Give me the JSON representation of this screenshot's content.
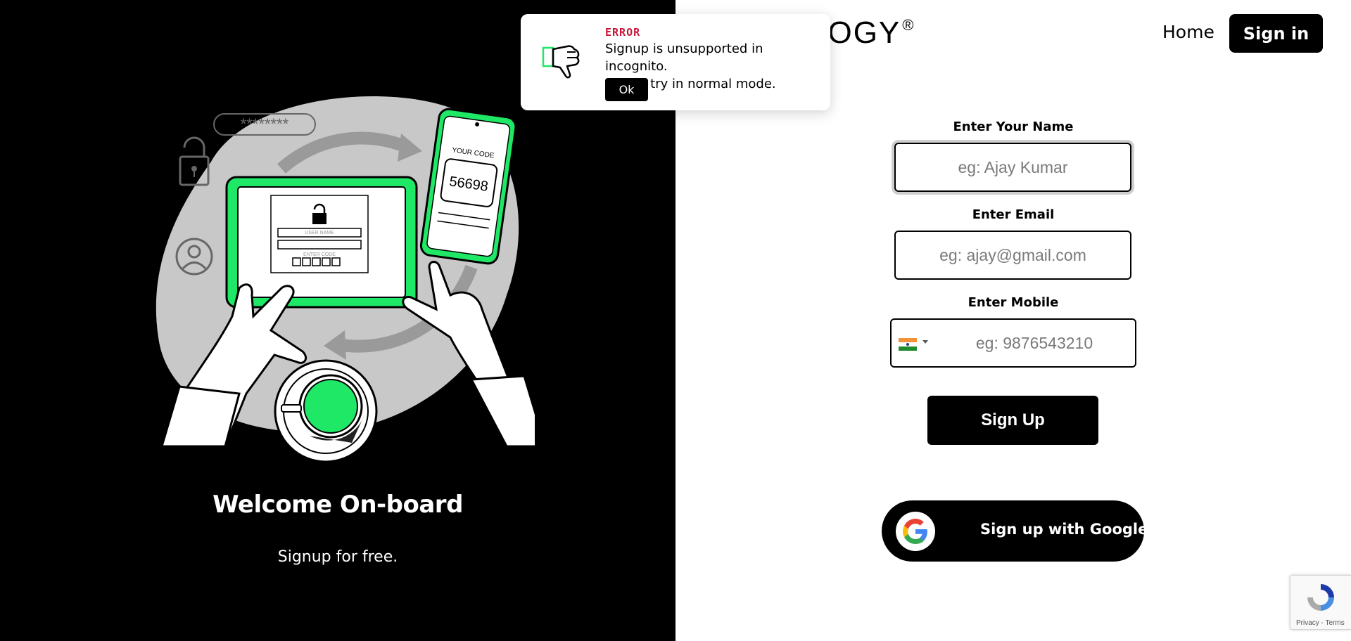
{
  "brand": {
    "logo_text": "LOGY",
    "logo_mark": "®"
  },
  "nav": {
    "home_label": "Home",
    "signin_label": "Sign in"
  },
  "hero": {
    "title": "Welcome On-board",
    "subtitle": "Signup for free.",
    "illustration": {
      "password_mask": "********",
      "phone_code_caption": "YOUR CODE",
      "phone_code": "56698",
      "tablet_username_caption": "USER NAME",
      "tablet_code_caption": "ENTER CODE",
      "accent_color": "#1ee866"
    }
  },
  "form": {
    "name": {
      "label": "Enter Your Name",
      "placeholder": "eg: Ajay Kumar",
      "value": ""
    },
    "email": {
      "label": "Enter Email",
      "placeholder": "eg: ajay@gmail.com",
      "value": ""
    },
    "mobile": {
      "label": "Enter Mobile",
      "placeholder": "eg: 9876543210",
      "value": "",
      "country_flag": "india-flag-icon"
    },
    "signup_label": "Sign Up",
    "google_label": "Sign up with Google"
  },
  "toast": {
    "kicker": "ERROR",
    "message_line1": "Signup is unsupported in incognito.",
    "message_line2": "Please try in normal mode.",
    "ok_label": "Ok",
    "icon": "thumbs-down-icon"
  },
  "recaptcha": {
    "links": "Privacy - Terms"
  },
  "colors": {
    "accent_green": "#1ee866",
    "error_red": "#c5163b",
    "dark": "#000000"
  }
}
